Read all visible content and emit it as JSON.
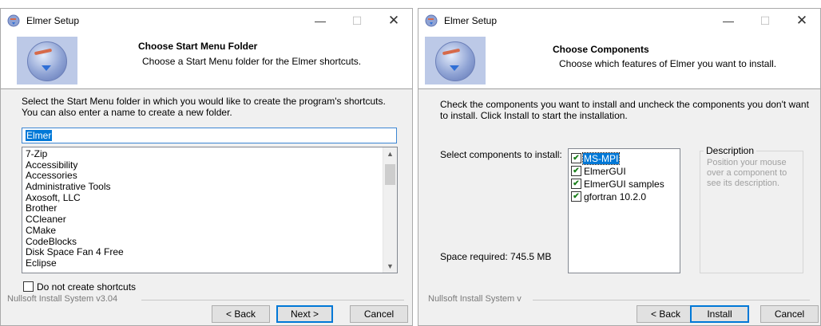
{
  "left_window": {
    "title": "Elmer Setup",
    "header_title": "Choose Start Menu Folder",
    "header_subtitle": "Choose a Start Menu folder for the Elmer shortcuts.",
    "intro": "Select the Start Menu folder in which you would like to create the program's shortcuts. You can also enter a name to create a new folder.",
    "folder_value": "Elmer",
    "folders": [
      "7-Zip",
      "Accessibility",
      "Accessories",
      "Administrative Tools",
      "Axosoft, LLC",
      "Brother",
      "CCleaner",
      "CMake",
      "CodeBlocks",
      "Disk Space Fan 4 Free",
      "Eclipse"
    ],
    "no_shortcuts_label": "Do not create shortcuts",
    "nsis_label": "Nullsoft Install System v3.04",
    "back_label": "< Back",
    "next_label": "Next >",
    "cancel_label": "Cancel"
  },
  "right_window": {
    "title": "Elmer Setup",
    "header_title": "Choose Components",
    "header_subtitle": "Choose which features of Elmer you want to install.",
    "intro": "Check the components you want to install and uncheck the components you don't want to install. Click Install to start the installation.",
    "select_label": "Select components to install:",
    "components": [
      {
        "label": "MS-MPI",
        "checked": true,
        "selected": true
      },
      {
        "label": "ElmerGUI",
        "checked": true,
        "selected": false
      },
      {
        "label": "ElmerGUI samples",
        "checked": true,
        "selected": false
      },
      {
        "label": "gfortran 10.2.0",
        "checked": true,
        "selected": false
      }
    ],
    "description_title": "Description",
    "description_text": "Position your mouse over a component to see its description.",
    "space_required": "Space required: 745.5 MB",
    "nsis_label": "Nullsoft Install System v",
    "back_label": "< Back",
    "install_label": "Install",
    "cancel_label": "Cancel"
  },
  "window_controls": {
    "minimize": "—",
    "maximize": "☐",
    "close": "✕"
  },
  "icons": {
    "scroll_up": "▲",
    "scroll_down": "▼",
    "check": "✔"
  }
}
